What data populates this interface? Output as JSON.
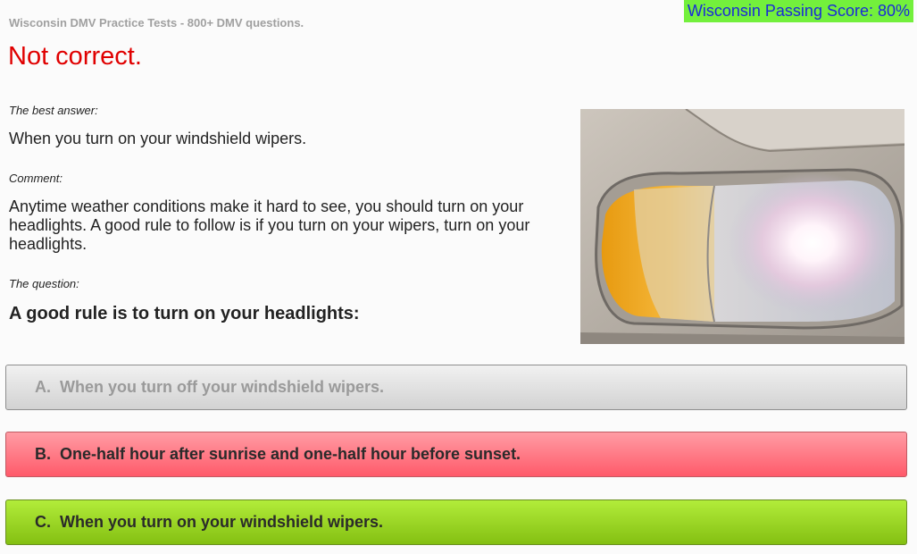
{
  "header": {
    "site_title": "Wisconsin DMV Practice Tests - 800+ DMV questions.",
    "passing_score": "Wisconsin Passing Score: 80%",
    "passing_score_bg": "#73f03c",
    "passing_score_color": "#1a2ad8"
  },
  "result": {
    "verdict": "Not correct.",
    "verdict_color": "#e00000",
    "best_answer_label": "The best answer:",
    "best_answer": "When you turn on your windshield wipers.",
    "comment_label": "Comment:",
    "comment": "Anytime weather conditions make it hard to see, you should turn on your headlights. A good rule to follow is if you turn on your wipers, turn on your headlights.",
    "question_label": "The question:",
    "question": "A good rule is to turn on your headlights:"
  },
  "image": {
    "subject": "car-headlight-photo"
  },
  "answers": [
    {
      "letter": "A.",
      "text": "When you turn off your windshield wipers.",
      "state": "unselected",
      "color": "#d2d2d2"
    },
    {
      "letter": "B.",
      "text": "One-half hour after sunrise and one-half hour before sunset.",
      "state": "wrong",
      "color": "#ff5a6a"
    },
    {
      "letter": "C.",
      "text": "When you turn on your windshield wipers.",
      "state": "correct",
      "color": "#84c012"
    }
  ]
}
